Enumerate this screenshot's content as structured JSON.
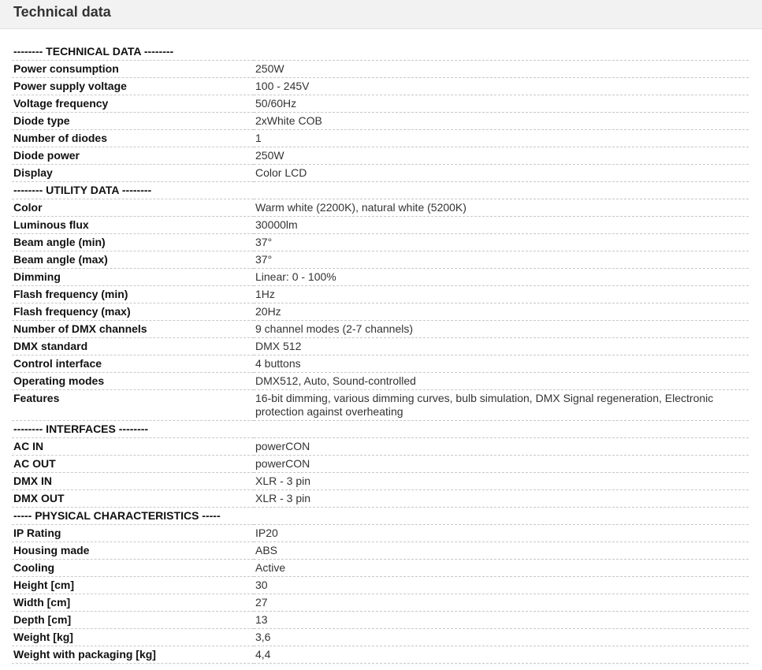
{
  "header": {
    "title": "Technical data"
  },
  "rows": [
    {
      "type": "section",
      "label": "-------- TECHNICAL DATA --------"
    },
    {
      "type": "row",
      "label": "Power consumption",
      "value": "250W"
    },
    {
      "type": "row",
      "label": "Power supply voltage",
      "value": "100 - 245V"
    },
    {
      "type": "row",
      "label": "Voltage frequency",
      "value": "50/60Hz"
    },
    {
      "type": "row",
      "label": "Diode type",
      "value": "2xWhite COB"
    },
    {
      "type": "row",
      "label": "Number of diodes",
      "value": "1"
    },
    {
      "type": "row",
      "label": "Diode power",
      "value": "250W"
    },
    {
      "type": "row",
      "label": "Display",
      "value": "Color LCD"
    },
    {
      "type": "section",
      "label": "-------- UTILITY DATA --------"
    },
    {
      "type": "row",
      "label": "Color",
      "value": "Warm white (2200K), natural white (5200K)"
    },
    {
      "type": "row",
      "label": "Luminous flux",
      "value": "30000lm"
    },
    {
      "type": "row",
      "label": "Beam angle (min)",
      "value": "37°"
    },
    {
      "type": "row",
      "label": "Beam angle (max)",
      "value": "37°"
    },
    {
      "type": "row",
      "label": "Dimming",
      "value": "Linear: 0 - 100%"
    },
    {
      "type": "row",
      "label": "Flash frequency (min)",
      "value": "1Hz"
    },
    {
      "type": "row",
      "label": "Flash frequency (max)",
      "value": "20Hz"
    },
    {
      "type": "row",
      "label": "Number of DMX channels",
      "value": "9 channel modes (2-7 channels)"
    },
    {
      "type": "row",
      "label": "DMX standard",
      "value": "DMX 512"
    },
    {
      "type": "row",
      "label": "Control interface",
      "value": "4 buttons"
    },
    {
      "type": "row",
      "label": "Operating modes",
      "value": "DMX512, Auto, Sound-controlled"
    },
    {
      "type": "row",
      "label": "Features",
      "value": "16-bit dimming, various dimming curves, bulb simulation, DMX Signal regeneration, Electronic protection against overheating"
    },
    {
      "type": "section",
      "label": "-------- INTERFACES --------"
    },
    {
      "type": "row",
      "label": "AC IN",
      "value": "powerCON"
    },
    {
      "type": "row",
      "label": "AC OUT",
      "value": "powerCON"
    },
    {
      "type": "row",
      "label": "DMX IN",
      "value": "XLR - 3 pin"
    },
    {
      "type": "row",
      "label": "DMX OUT",
      "value": "XLR - 3 pin"
    },
    {
      "type": "section",
      "label": "----- PHYSICAL CHARACTERISTICS -----"
    },
    {
      "type": "row",
      "label": "IP Rating",
      "value": "IP20"
    },
    {
      "type": "row",
      "label": "Housing made",
      "value": "ABS"
    },
    {
      "type": "row",
      "label": "Cooling",
      "value": "Active"
    },
    {
      "type": "row",
      "label": "Height [cm]",
      "value": "30"
    },
    {
      "type": "row",
      "label": "Width [cm]",
      "value": "27"
    },
    {
      "type": "row",
      "label": "Depth [cm]",
      "value": "13"
    },
    {
      "type": "row",
      "label": "Weight [kg]",
      "value": "3,6"
    },
    {
      "type": "row",
      "label": "Weight with packaging [kg]",
      "value": "4,4"
    }
  ]
}
